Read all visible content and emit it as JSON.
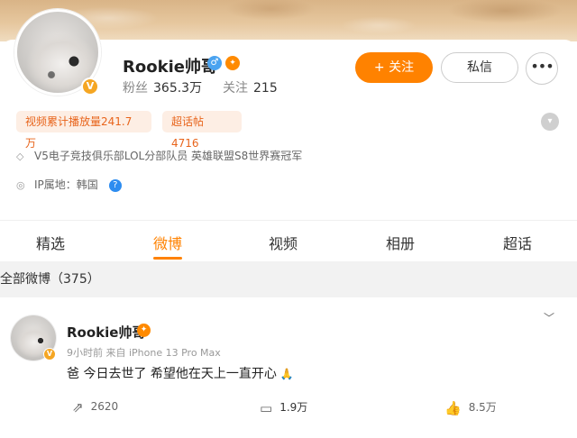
{
  "profile": {
    "name": "Rookie帅哥",
    "fans_label": "粉丝",
    "fans_value": "365.3万",
    "following_label": "关注",
    "following_value": "215",
    "follow_button": "+ 关注",
    "message_button": "私信",
    "more_button": "•••",
    "tags": [
      "视频累计播放量241.7万",
      "超话帖 4716"
    ],
    "bio": "V5电子竞技俱乐部LOL分部队员 英雄联盟S8世界赛冠军",
    "ip": "IP属地：韩国",
    "verified_badge": "V",
    "gender_symbol": "♂"
  },
  "tabs": [
    "精选",
    "微博",
    "视频",
    "相册",
    "超话"
  ],
  "active_tab": "微博",
  "section": {
    "title": "全部微博（375）"
  },
  "post": {
    "author": "Rookie帅哥",
    "meta": "9小时前 来自 iPhone 13 Pro Max",
    "text": "爸 今日去世了 希望他在天上一直开心",
    "reposts": "2620",
    "comments": "1.9万",
    "likes": "8.5万"
  },
  "colors": {
    "accent": "#ff8200",
    "tag_bg": "#fdeee4",
    "tag_text": "#e8641b",
    "section_bg": "#f2f2f2"
  },
  "icons": [
    "gender-male-icon",
    "crown-badge-icon",
    "verified-icon",
    "expand-icon",
    "shield-icon",
    "location-icon",
    "help-icon",
    "chevron-down-icon",
    "repost-icon",
    "comment-icon",
    "like-icon",
    "pray-emoji-icon"
  ]
}
